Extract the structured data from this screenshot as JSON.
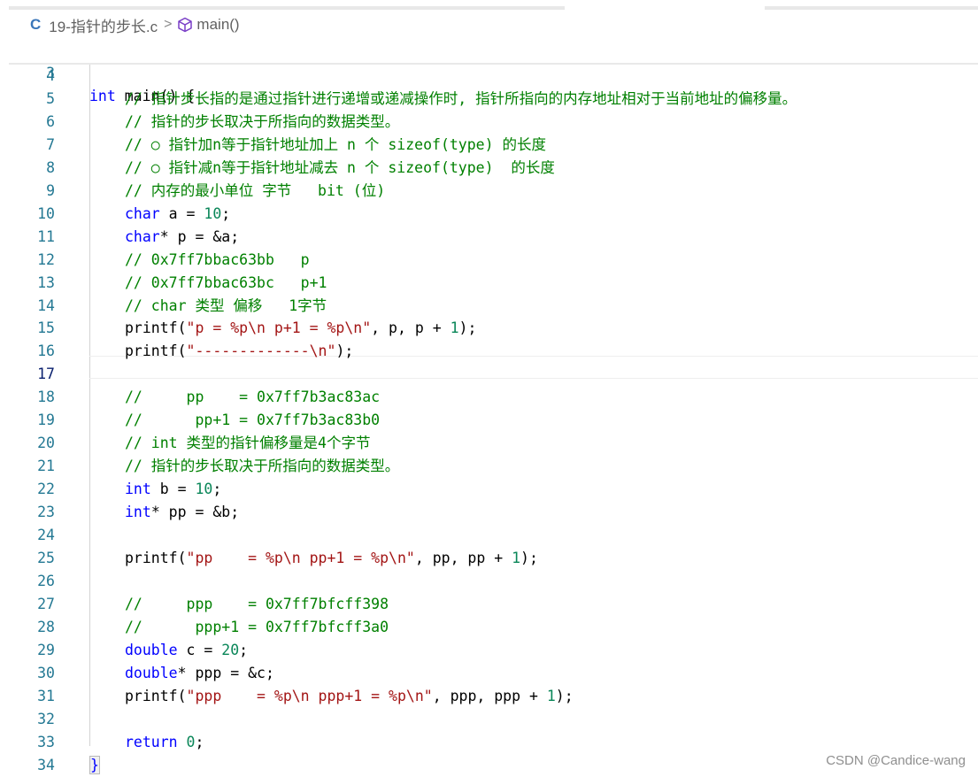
{
  "editor": {
    "breadcrumb": {
      "file_icon_label": "C",
      "file_name": "19-指针的步长.c",
      "separator": ">",
      "symbol_icon": "cube-icon",
      "symbol_name": "main()"
    },
    "sticky_line": {
      "number": "3",
      "tokens": [
        {
          "t": "int",
          "c": "kw"
        },
        {
          "t": " main() {",
          "c": "plain"
        }
      ]
    },
    "lines": [
      {
        "n": "4",
        "indent": false,
        "tokens": []
      },
      {
        "n": "5",
        "indent": true,
        "tokens": [
          {
            "t": "// 指针步长指的是通过指针进行递增或递减操作时, 指针所指向的内存地址相对于当前地址的偏移量。",
            "c": "cm"
          }
        ]
      },
      {
        "n": "6",
        "indent": true,
        "tokens": [
          {
            "t": "// 指针的步长取决于所指向的数据类型。",
            "c": "cm"
          }
        ]
      },
      {
        "n": "7",
        "indent": true,
        "tokens": [
          {
            "t": "// ○ 指针加n等于指针地址加上 n 个 sizeof(type) 的长度",
            "c": "cm"
          }
        ]
      },
      {
        "n": "8",
        "indent": true,
        "tokens": [
          {
            "t": "// ○ 指针减n等于指针地址减去 n 个 sizeof(type)  的长度",
            "c": "cm"
          }
        ]
      },
      {
        "n": "9",
        "indent": true,
        "tokens": [
          {
            "t": "// 内存的最小单位 字节   bit (位)",
            "c": "cm"
          }
        ]
      },
      {
        "n": "10",
        "indent": true,
        "tokens": [
          {
            "t": "char",
            "c": "ty"
          },
          {
            "t": " a = ",
            "c": "plain"
          },
          {
            "t": "10",
            "c": "num"
          },
          {
            "t": ";",
            "c": "plain"
          }
        ]
      },
      {
        "n": "11",
        "indent": true,
        "tokens": [
          {
            "t": "char",
            "c": "ty"
          },
          {
            "t": "* p = &a;",
            "c": "plain"
          }
        ]
      },
      {
        "n": "12",
        "indent": true,
        "tokens": [
          {
            "t": "// 0x7ff7bbac63bb   p",
            "c": "cm"
          }
        ]
      },
      {
        "n": "13",
        "indent": true,
        "tokens": [
          {
            "t": "// 0x7ff7bbac63bc   p+1",
            "c": "cm"
          }
        ]
      },
      {
        "n": "14",
        "indent": true,
        "tokens": [
          {
            "t": "// char 类型 偏移   1字节",
            "c": "cm"
          }
        ]
      },
      {
        "n": "15",
        "indent": true,
        "tokens": [
          {
            "t": "printf(",
            "c": "plain"
          },
          {
            "t": "\"p = %p\\n p+1 = %p\\n\"",
            "c": "str"
          },
          {
            "t": ", p, p + ",
            "c": "plain"
          },
          {
            "t": "1",
            "c": "num"
          },
          {
            "t": ");",
            "c": "plain"
          }
        ]
      },
      {
        "n": "16",
        "indent": true,
        "tokens": [
          {
            "t": "printf(",
            "c": "plain"
          },
          {
            "t": "\"-------------\\n\"",
            "c": "str"
          },
          {
            "t": ");",
            "c": "plain"
          }
        ]
      },
      {
        "n": "17",
        "indent": false,
        "tokens": []
      },
      {
        "n": "18",
        "indent": true,
        "tokens": [
          {
            "t": "//     pp    = 0x7ff7b3ac83ac",
            "c": "cm"
          }
        ]
      },
      {
        "n": "19",
        "indent": true,
        "tokens": [
          {
            "t": "//      pp+1 = 0x7ff7b3ac83b0",
            "c": "cm"
          }
        ]
      },
      {
        "n": "20",
        "indent": true,
        "tokens": [
          {
            "t": "// int 类型的指针偏移量是4个字节",
            "c": "cm"
          }
        ]
      },
      {
        "n": "21",
        "indent": true,
        "tokens": [
          {
            "t": "// 指针的步长取决于所指向的数据类型。",
            "c": "cm"
          }
        ]
      },
      {
        "n": "22",
        "indent": true,
        "tokens": [
          {
            "t": "int",
            "c": "ty"
          },
          {
            "t": " b = ",
            "c": "plain"
          },
          {
            "t": "10",
            "c": "num"
          },
          {
            "t": ";",
            "c": "plain"
          }
        ]
      },
      {
        "n": "23",
        "indent": true,
        "tokens": [
          {
            "t": "int",
            "c": "ty"
          },
          {
            "t": "* pp = &b;",
            "c": "plain"
          }
        ]
      },
      {
        "n": "24",
        "indent": false,
        "tokens": []
      },
      {
        "n": "25",
        "indent": true,
        "tokens": [
          {
            "t": "printf(",
            "c": "plain"
          },
          {
            "t": "\"pp    = %p\\n pp+1 = %p\\n\"",
            "c": "str"
          },
          {
            "t": ", pp, pp + ",
            "c": "plain"
          },
          {
            "t": "1",
            "c": "num"
          },
          {
            "t": ");",
            "c": "plain"
          }
        ]
      },
      {
        "n": "26",
        "indent": false,
        "tokens": []
      },
      {
        "n": "27",
        "indent": true,
        "tokens": [
          {
            "t": "//     ppp    = 0x7ff7bfcff398",
            "c": "cm"
          }
        ]
      },
      {
        "n": "28",
        "indent": true,
        "tokens": [
          {
            "t": "//      ppp+1 = 0x7ff7bfcff3a0",
            "c": "cm"
          }
        ]
      },
      {
        "n": "29",
        "indent": true,
        "tokens": [
          {
            "t": "double",
            "c": "ty"
          },
          {
            "t": " c = ",
            "c": "plain"
          },
          {
            "t": "20",
            "c": "num"
          },
          {
            "t": ";",
            "c": "plain"
          }
        ]
      },
      {
        "n": "30",
        "indent": true,
        "tokens": [
          {
            "t": "double",
            "c": "ty"
          },
          {
            "t": "* ppp = &c;",
            "c": "plain"
          }
        ]
      },
      {
        "n": "31",
        "indent": true,
        "tokens": [
          {
            "t": "printf(",
            "c": "plain"
          },
          {
            "t": "\"ppp    = %p\\n ppp+1 = %p\\n\"",
            "c": "str"
          },
          {
            "t": ", ppp, ppp + ",
            "c": "plain"
          },
          {
            "t": "1",
            "c": "num"
          },
          {
            "t": ");",
            "c": "plain"
          }
        ]
      },
      {
        "n": "32",
        "indent": false,
        "tokens": []
      },
      {
        "n": "33",
        "indent": true,
        "tokens": [
          {
            "t": "return",
            "c": "kw"
          },
          {
            "t": " ",
            "c": "plain"
          },
          {
            "t": "0",
            "c": "num"
          },
          {
            "t": ";",
            "c": "plain"
          }
        ]
      },
      {
        "n": "34",
        "indent": false,
        "tokens": [
          {
            "t": "}",
            "c": "kw",
            "brace": true
          }
        ]
      }
    ],
    "active_line": "17"
  },
  "watermark": "CSDN @Candice-wang",
  "colors": {
    "keyword": "#0000ff",
    "number": "#098658",
    "string": "#a31515",
    "comment": "#008000",
    "line_number": "#237893"
  }
}
